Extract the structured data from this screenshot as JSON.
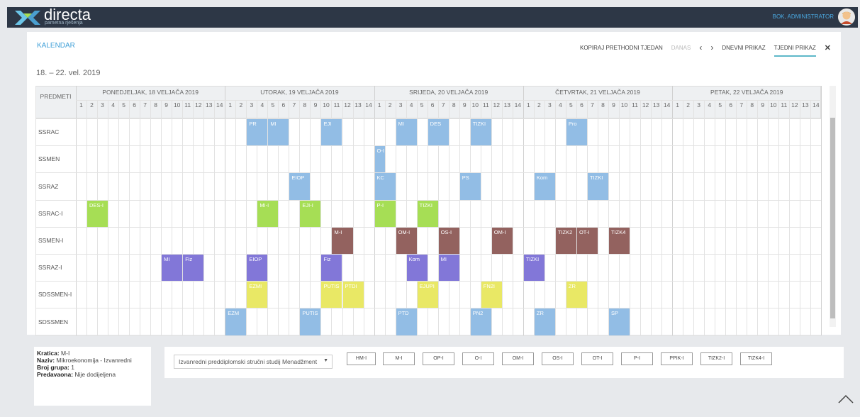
{
  "app": {
    "logo": "directa",
    "logo_sub": "pametna rješenja",
    "user": "BOK, ADMINISTRATOR"
  },
  "calendar": {
    "title": "KALENDAR",
    "date_range": "18. – 22. vel. 2019",
    "toolbar": {
      "copy": "KOPIRAJ PRETHODNI TJEDAN",
      "today": "DANAS",
      "prev": "‹",
      "next": "›",
      "daily": "DNEVNI PRIKAZ",
      "weekly": "TJEDNI PRIKAZ",
      "close": "✕"
    },
    "row_header": "PREDMETI",
    "days": [
      "PONEDJELJAK, 18 VELJAČA 2019",
      "UTORAK, 19 VELJAČA 2019",
      "SRIJEDA, 20 VELJAČA 2019",
      "ČETVRTAK, 21 VELJAČA 2019",
      "PETAK, 22 VELJAČA 2019"
    ],
    "hours": [
      "1",
      "2",
      "3",
      "4",
      "5",
      "6",
      "7",
      "8",
      "9",
      "10",
      "11",
      "12",
      "13",
      "14"
    ],
    "rows": [
      "SSRAC",
      "SSMEN",
      "SSRAZ",
      "SSRAC-I",
      "SSMEN-I",
      "SSRAZ-I",
      "SDSSMEN-I",
      "SDSSMEN"
    ],
    "events": [
      {
        "row": 0,
        "day": 1,
        "hour": 3,
        "span": 2,
        "label": "PR",
        "color": "blue"
      },
      {
        "row": 0,
        "day": 1,
        "hour": 5,
        "span": 2,
        "label": "MI",
        "color": "blue"
      },
      {
        "row": 0,
        "day": 1,
        "hour": 10,
        "span": 2,
        "label": "EJI",
        "color": "blue"
      },
      {
        "row": 0,
        "day": 2,
        "hour": 3,
        "span": 2,
        "label": "MI",
        "color": "blue"
      },
      {
        "row": 0,
        "day": 2,
        "hour": 6,
        "span": 2,
        "label": "DES",
        "color": "blue"
      },
      {
        "row": 0,
        "day": 2,
        "hour": 10,
        "span": 2,
        "label": "TIZKI",
        "color": "blue"
      },
      {
        "row": 0,
        "day": 3,
        "hour": 5,
        "span": 2,
        "label": "Pro",
        "color": "blue"
      },
      {
        "row": 1,
        "day": 2,
        "hour": 1,
        "span": 1,
        "label": "O-I",
        "color": "blue"
      },
      {
        "row": 2,
        "day": 1,
        "hour": 7,
        "span": 2,
        "label": "EIOP",
        "color": "blue"
      },
      {
        "row": 2,
        "day": 2,
        "hour": 1,
        "span": 2,
        "label": "KC",
        "color": "blue"
      },
      {
        "row": 2,
        "day": 2,
        "hour": 9,
        "span": 2,
        "label": "PS",
        "color": "blue"
      },
      {
        "row": 2,
        "day": 3,
        "hour": 2,
        "span": 2,
        "label": "Kom",
        "color": "blue"
      },
      {
        "row": 2,
        "day": 3,
        "hour": 7,
        "span": 2,
        "label": "TIZKI",
        "color": "blue"
      },
      {
        "row": 3,
        "day": 0,
        "hour": 2,
        "span": 2,
        "label": "DES-I",
        "color": "green"
      },
      {
        "row": 3,
        "day": 1,
        "hour": 4,
        "span": 2,
        "label": "MI-I",
        "color": "green"
      },
      {
        "row": 3,
        "day": 1,
        "hour": 8,
        "span": 2,
        "label": "EJI-I",
        "color": "green"
      },
      {
        "row": 3,
        "day": 2,
        "hour": 1,
        "span": 2,
        "label": "P-I",
        "color": "green"
      },
      {
        "row": 3,
        "day": 2,
        "hour": 5,
        "span": 2,
        "label": "TIZKI",
        "color": "green"
      },
      {
        "row": 4,
        "day": 1,
        "hour": 11,
        "span": 2,
        "label": "M-I",
        "color": "brown"
      },
      {
        "row": 4,
        "day": 2,
        "hour": 3,
        "span": 2,
        "label": "OM-I",
        "color": "brown"
      },
      {
        "row": 4,
        "day": 2,
        "hour": 7,
        "span": 2,
        "label": "OS-I",
        "color": "brown"
      },
      {
        "row": 4,
        "day": 2,
        "hour": 12,
        "span": 2,
        "label": "OM-I",
        "color": "brown"
      },
      {
        "row": 4,
        "day": 3,
        "hour": 4,
        "span": 2,
        "label": "TIZK2",
        "color": "brown"
      },
      {
        "row": 4,
        "day": 3,
        "hour": 6,
        "span": 2,
        "label": "OT-I",
        "color": "brown"
      },
      {
        "row": 4,
        "day": 3,
        "hour": 9,
        "span": 2,
        "label": "TIZK4",
        "color": "brown"
      },
      {
        "row": 5,
        "day": 0,
        "hour": 9,
        "span": 2,
        "label": "MI",
        "color": "purple"
      },
      {
        "row": 5,
        "day": 0,
        "hour": 11,
        "span": 2,
        "label": "Fiz",
        "color": "purple"
      },
      {
        "row": 5,
        "day": 1,
        "hour": 3,
        "span": 2,
        "label": "EIOP",
        "color": "purple"
      },
      {
        "row": 5,
        "day": 1,
        "hour": 10,
        "span": 2,
        "label": "Fiz",
        "color": "purple"
      },
      {
        "row": 5,
        "day": 2,
        "hour": 4,
        "span": 2,
        "label": "Kom",
        "color": "purple"
      },
      {
        "row": 5,
        "day": 2,
        "hour": 7,
        "span": 2,
        "label": "MI",
        "color": "purple"
      },
      {
        "row": 5,
        "day": 3,
        "hour": 1,
        "span": 2,
        "label": "TIZKI",
        "color": "purple"
      },
      {
        "row": 6,
        "day": 1,
        "hour": 3,
        "span": 2,
        "label": "EZMI",
        "color": "yellow"
      },
      {
        "row": 6,
        "day": 1,
        "hour": 10,
        "span": 2,
        "label": "PUTIS",
        "color": "yellow"
      },
      {
        "row": 6,
        "day": 1,
        "hour": 12,
        "span": 2,
        "label": "PTDI",
        "color": "yellow"
      },
      {
        "row": 6,
        "day": 2,
        "hour": 5,
        "span": 2,
        "label": "EJUPI",
        "color": "yellow"
      },
      {
        "row": 6,
        "day": 2,
        "hour": 11,
        "span": 2,
        "label": "FN2I",
        "color": "yellow"
      },
      {
        "row": 6,
        "day": 3,
        "hour": 5,
        "span": 2,
        "label": "ZR",
        "color": "yellow"
      },
      {
        "row": 7,
        "day": 1,
        "hour": 1,
        "span": 2,
        "label": "EZM",
        "color": "blue"
      },
      {
        "row": 7,
        "day": 1,
        "hour": 8,
        "span": 2,
        "label": "PUTIS",
        "color": "blue"
      },
      {
        "row": 7,
        "day": 2,
        "hour": 3,
        "span": 2,
        "label": "PTD",
        "color": "blue"
      },
      {
        "row": 7,
        "day": 2,
        "hour": 10,
        "span": 2,
        "label": "PN2",
        "color": "blue"
      },
      {
        "row": 7,
        "day": 3,
        "hour": 2,
        "span": 2,
        "label": "ZR",
        "color": "blue"
      },
      {
        "row": 7,
        "day": 3,
        "hour": 9,
        "span": 2,
        "label": "SP",
        "color": "blue"
      }
    ]
  },
  "colors": {
    "blue": "#92bde5",
    "green": "#a6de55",
    "brown": "#93625f",
    "purple": "#8277d8",
    "yellow": "#e9e865"
  },
  "info": {
    "kratica_label": "Kratica:",
    "kratica": "M-I",
    "naziv_label": "Naziv:",
    "naziv": "Mikroekonomija - Izvanredni",
    "broj_label": "Broj grupa:",
    "broj": "1",
    "predavaona_label": "Predavaona:",
    "predavaona": "Nije dodijeljena"
  },
  "filter": {
    "program": "Izvanredni preddiplomski stručni studij Menadžment",
    "groups": [
      "HM-I",
      "M-I",
      "OP-I",
      "O-I",
      "OM-I",
      "OS-I",
      "OT-I",
      "P-I",
      "PPIK-I",
      "TIZK2-I",
      "TIZK4-I"
    ]
  }
}
